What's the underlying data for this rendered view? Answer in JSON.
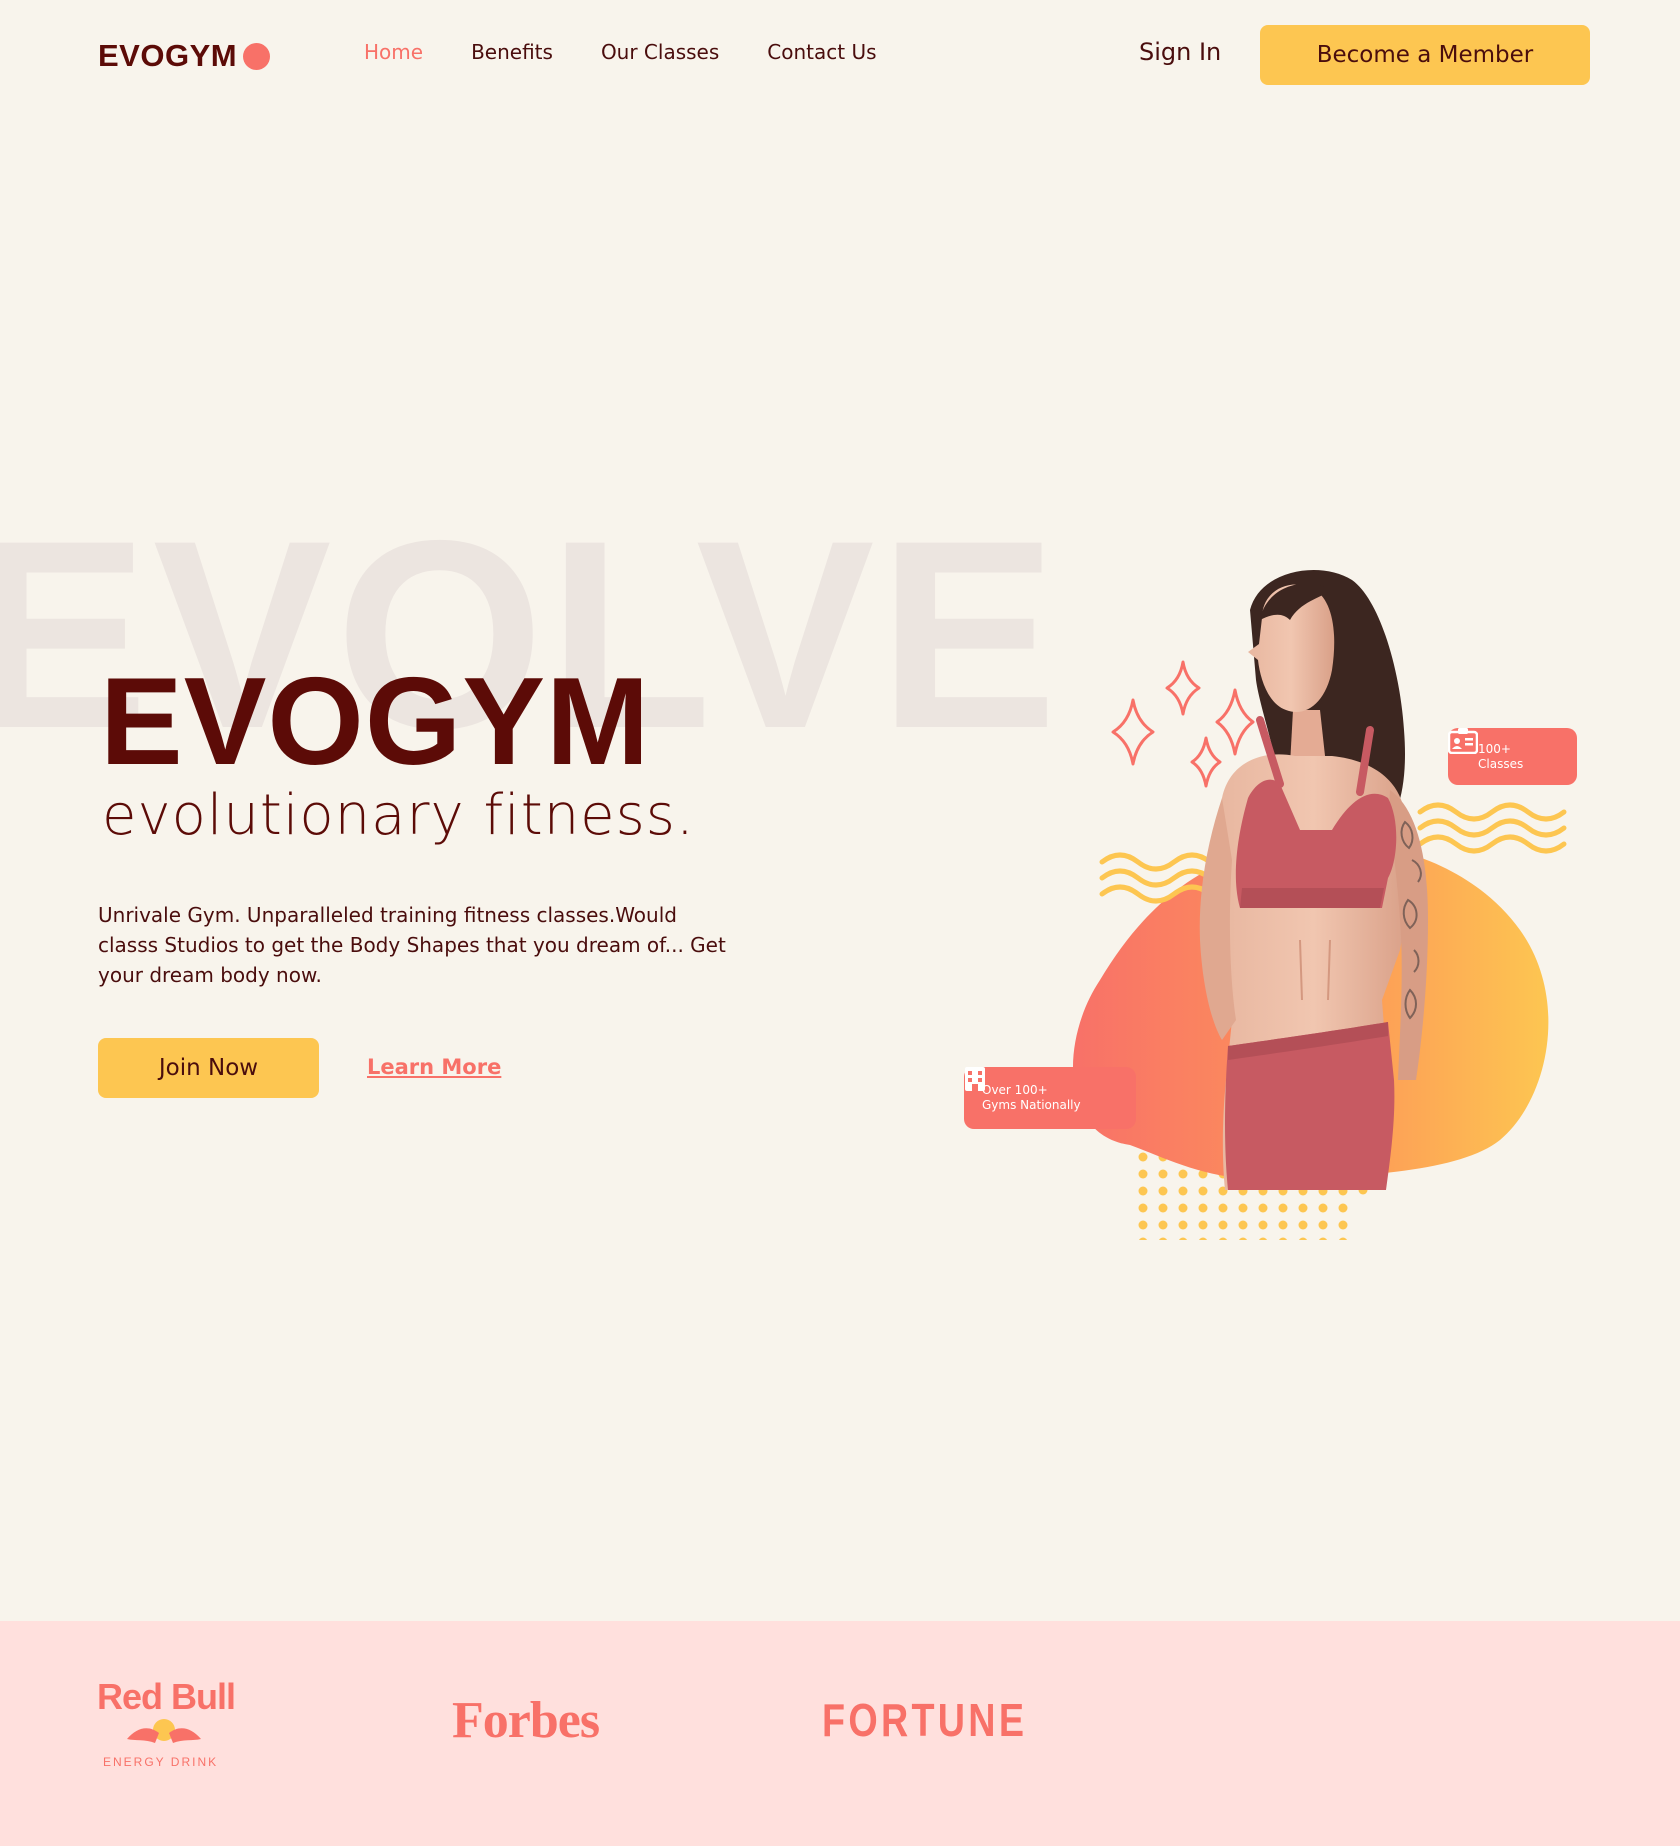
{
  "brand": {
    "name": "EVOGYM",
    "accent": "#f87168",
    "primary": "#5c0b07",
    "button": "#fdc651",
    "background": "#f8f4ec",
    "sponsor_background": "#ffe0dd"
  },
  "nav": {
    "links": [
      "Home",
      "Benefits",
      "Our Classes",
      "Contact Us"
    ],
    "active": "Home",
    "sign_in": "Sign In",
    "cta": "Become a Member"
  },
  "hero": {
    "background_word": "EVOLVE",
    "title": "EVOGYM",
    "subtitle": "evolutionary fitness.",
    "description": "Unrivale Gym. Unparalleled training fitness classes.Would classs Studios to get the Body Shapes that you dream of... Get your dream body now.",
    "primary_button": "Join Now",
    "secondary_link": "Learn More",
    "badges": {
      "classes": [
        "100+",
        "Classes"
      ],
      "gyms": [
        "Over 100+",
        "Gyms Nationally"
      ]
    }
  },
  "sponsors": {
    "redbull": {
      "name": "Red Bull",
      "tagline": "ENERGY DRINK"
    },
    "forbes": "Forbes",
    "fortune": "FORTUNE"
  }
}
